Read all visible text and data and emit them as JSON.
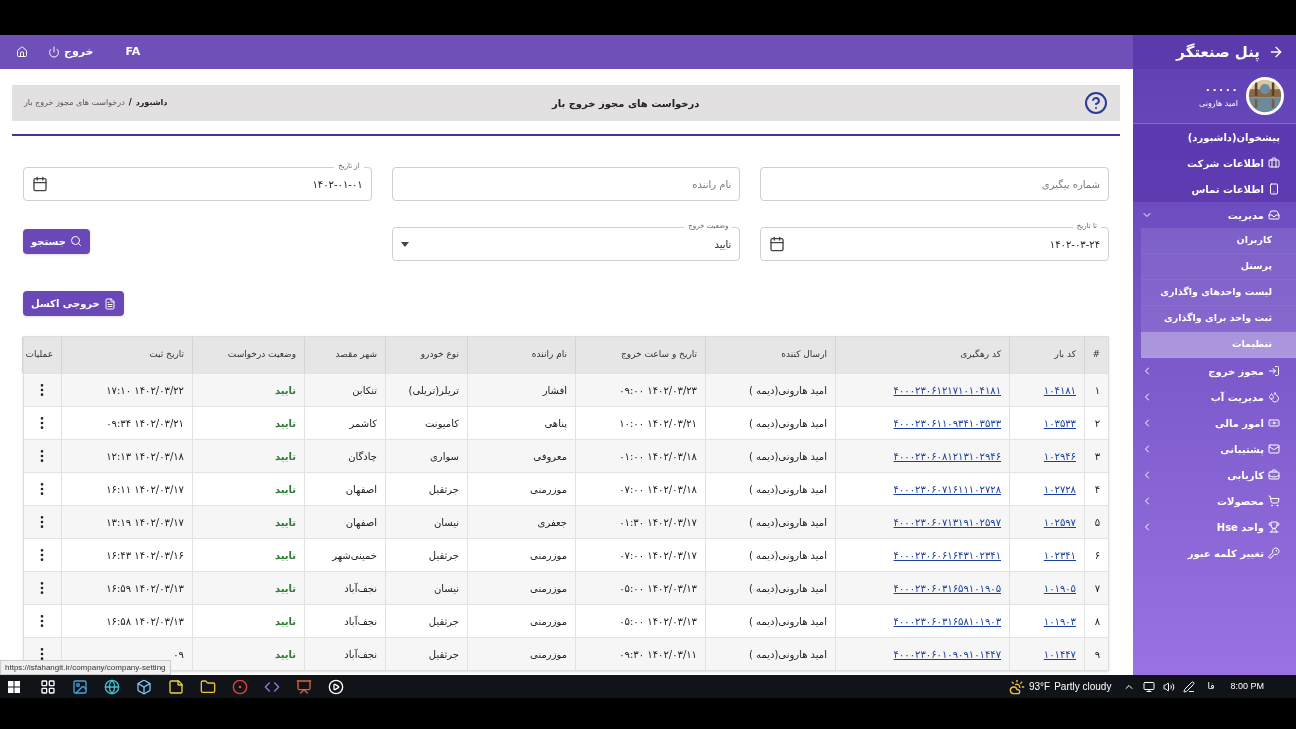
{
  "top_bar": {
    "language": "FA",
    "logout": "خروج"
  },
  "sidebar": {
    "title": "پنل صنعتگر",
    "profile": {
      "code": "۰۰۰۰۰",
      "name": "امید هارونی"
    },
    "items": [
      {
        "kind": "link",
        "label": "پیشخوان(داشبورد)"
      },
      {
        "kind": "link",
        "label": "اطلاعات شرکت"
      },
      {
        "kind": "link",
        "label": "اطلاعات تماس"
      },
      {
        "kind": "group",
        "label": "مدیریت",
        "expanded": true,
        "children": [
          {
            "label": "کاربران",
            "selected": false
          },
          {
            "label": "پرسنل",
            "selected": false
          },
          {
            "label": "لیست واحدهای واگذاری",
            "selected": false
          },
          {
            "label": "ثبت واحد برای واگذاری",
            "selected": false
          },
          {
            "label": "تنظیمات",
            "selected": true
          }
        ]
      },
      {
        "kind": "group",
        "label": "مجوز خروج",
        "expanded": false
      },
      {
        "kind": "group",
        "label": "مدیریت آب",
        "expanded": false
      },
      {
        "kind": "group",
        "label": "امور مالی",
        "expanded": false
      },
      {
        "kind": "group",
        "label": "پشتیبانی",
        "expanded": false
      },
      {
        "kind": "group",
        "label": "کاریابی",
        "expanded": false
      },
      {
        "kind": "group",
        "label": "محصولات",
        "expanded": false
      },
      {
        "kind": "group",
        "label": "واحد Hse",
        "expanded": false
      },
      {
        "kind": "link",
        "label": "تغییر کلمه عبور"
      }
    ]
  },
  "breadcrumb": {
    "home": "داشبورد",
    "separator": "/",
    "current": "درخواست های مجوز خروج بار"
  },
  "page_title": "درخواست های مجوز خروج بار",
  "filters": [
    {
      "kind": "text",
      "placeholder": "شماره پیگیری"
    },
    {
      "kind": "text",
      "placeholder": "نام راننده"
    },
    {
      "kind": "date",
      "label": "از تاریخ",
      "value": "۱۴۰۲-۰۱-۰۱"
    },
    {
      "kind": "date",
      "label": "تا تاریخ",
      "value": "۱۴۰۲-۰۳-۲۴"
    },
    {
      "kind": "select",
      "label": "وضعیت خروج",
      "value": "تایید"
    },
    {
      "kind": "button",
      "label": "جستجو"
    }
  ],
  "export_button": "خروجی اکسل",
  "table": {
    "columns": [
      "#",
      "کد بار",
      "کد رهگیری",
      "ارسال کننده",
      "تاریخ و ساعت خروج",
      "نام راننده",
      "نوع خودرو",
      "شهر مقصد",
      "وضعیت درخواست",
      "تاریخ ثبت",
      "عملیات"
    ],
    "rows": [
      {
        "number": "۱",
        "load_code": "۱۰۴۱۸۱",
        "tracking_code": "۴۰۰۰۲۳۰۶۱۲۱۷۱۰۱۰۴۱۸۱",
        "sender": "امید هارونی(دیمه )",
        "exit_datetime": "۱۴۰۲/۰۳/۲۳ ۰۹:۰۰",
        "driver": "افشار",
        "vehicle": "تریلر(تریلی)",
        "destination": "تنکابن",
        "status": "تایید",
        "approved": true,
        "registered": "۱۴۰۲/۰۳/۲۲ ۱۷:۱۰"
      },
      {
        "number": "۲",
        "load_code": "۱۰۳۵۳۳",
        "tracking_code": "۴۰۰۰۲۳۰۶۱۱۰۹۳۴۱۰۳۵۳۳",
        "sender": "امید هارونی(دیمه )",
        "exit_datetime": "۱۴۰۲/۰۳/۲۱ ۱۰:۰۰",
        "driver": "پناهی",
        "vehicle": "کامیونت",
        "destination": "کاشمر",
        "status": "تایید",
        "approved": true,
        "registered": "۱۴۰۲/۰۳/۲۱ ۰۹:۳۴"
      },
      {
        "number": "۳",
        "load_code": "۱۰۲۹۴۶",
        "tracking_code": "۴۰۰۰۲۳۰۶۰۸۱۲۱۳۱۰۲۹۴۶",
        "sender": "امید هارونی(دیمه )",
        "exit_datetime": "۱۴۰۲/۰۳/۱۸ ۰۱:۰۰",
        "driver": "معروفی",
        "vehicle": "سواری",
        "destination": "چادگان",
        "status": "تایید",
        "approved": true,
        "registered": "۱۴۰۲/۰۳/۱۸ ۱۲:۱۳"
      },
      {
        "number": "۴",
        "load_code": "۱۰۲۷۲۸",
        "tracking_code": "۴۰۰۰۲۳۰۶۰۷۱۶۱۱۱۰۲۷۲۸",
        "sender": "امید هارونی(دیمه )",
        "exit_datetime": "۱۴۰۲/۰۳/۱۸ ۰۷:۰۰",
        "driver": "موزرمنی",
        "vehicle": "جرثقیل",
        "destination": "اصفهان",
        "status": "تایید",
        "approved": true,
        "registered": "۱۴۰۲/۰۳/۱۷ ۱۶:۱۱"
      },
      {
        "number": "۵",
        "load_code": "۱۰۲۵۹۷",
        "tracking_code": "۴۰۰۰۲۳۰۶۰۷۱۳۱۹۱۰۲۵۹۷",
        "sender": "امید هارونی(دیمه )",
        "exit_datetime": "۱۴۰۲/۰۳/۱۷ ۰۱:۳۰",
        "driver": "جعفری",
        "vehicle": "نیسان",
        "destination": "اصفهان",
        "status": "تایید",
        "approved": true,
        "registered": "۱۴۰۲/۰۳/۱۷ ۱۳:۱۹"
      },
      {
        "number": "۶",
        "load_code": "۱۰۲۳۴۱",
        "tracking_code": "۴۰۰۰۲۳۰۶۰۶۱۶۴۳۱۰۲۳۴۱",
        "sender": "امید هارونی(دیمه )",
        "exit_datetime": "۱۴۰۲/۰۳/۱۷ ۰۷:۰۰",
        "driver": "موزرمنی",
        "vehicle": "جرثقیل",
        "destination": "خمینی‌شهر",
        "status": "تایید",
        "approved": true,
        "registered": "۱۴۰۲/۰۳/۱۶ ۱۶:۴۳"
      },
      {
        "number": "۷",
        "load_code": "۱۰۱۹۰۵",
        "tracking_code": "۴۰۰۰۲۳۰۶۰۳۱۶۵۹۱۰۱۹۰۵",
        "sender": "امید هارونی(دیمه )",
        "exit_datetime": "۱۴۰۲/۰۳/۱۳ ۰۵:۰۰",
        "driver": "موزرمنی",
        "vehicle": "نیسان",
        "destination": "نجف‌آباد",
        "status": "تایید",
        "approved": true,
        "registered": "۱۴۰۲/۰۳/۱۳ ۱۶:۵۹"
      },
      {
        "number": "۸",
        "load_code": "۱۰۱۹۰۳",
        "tracking_code": "۴۰۰۰۲۳۰۶۰۳۱۶۵۸۱۰۱۹۰۳",
        "sender": "امید هارونی(دیمه )",
        "exit_datetime": "۱۴۰۲/۰۳/۱۳ ۰۵:۰۰",
        "driver": "موزرمنی",
        "vehicle": "جرثقیل",
        "destination": "نجف‌آباد",
        "status": "تایید",
        "approved": true,
        "registered": "۱۴۰۲/۰۳/۱۳ ۱۶:۵۸"
      },
      {
        "number": "۹",
        "load_code": "۱۰۱۴۴۷",
        "tracking_code": "۴۰۰۰۲۳۰۶۰۱۰۹۰۹۱۰۱۴۴۷",
        "sender": "امید هارونی(دیمه )",
        "exit_datetime": "۱۴۰۲/۰۳/۱۱ ۰۹:۳۰",
        "driver": "موزرمنی",
        "vehicle": "جرثقیل",
        "destination": "نجف‌آباد",
        "status": "تایید",
        "approved": true,
        "registered": "۰۹"
      }
    ]
  },
  "link_preview": "https://isfahangit.ir/company/company-setting",
  "taskbar": {
    "weather": {
      "temperature": "93°F",
      "condition": "Partly cloudy"
    },
    "input_language": "فا",
    "time": "8:00 PM"
  }
}
